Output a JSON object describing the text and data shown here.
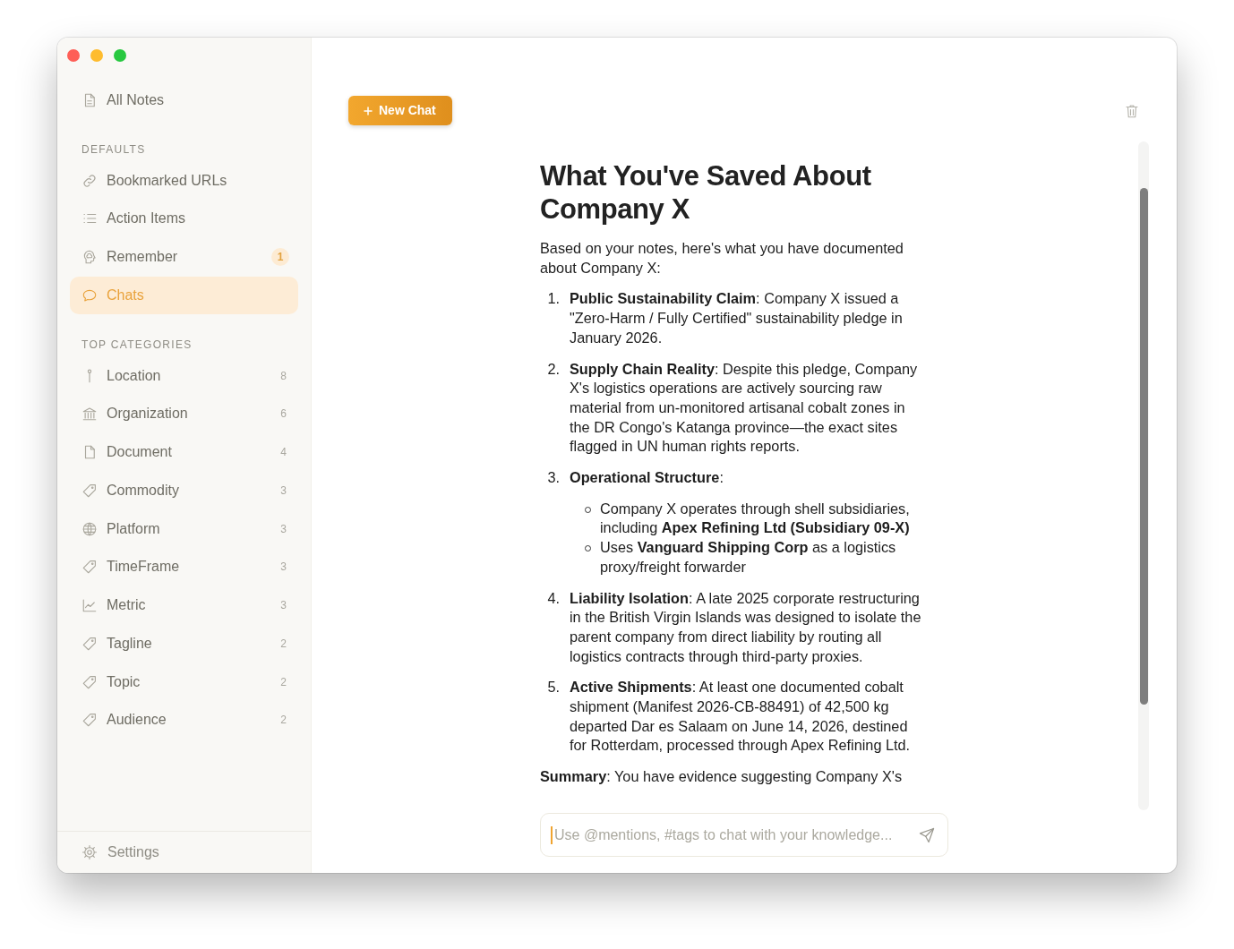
{
  "sidebar": {
    "top_item": {
      "label": "All Notes",
      "kind": "notes",
      "selected": false
    },
    "sections": [
      {
        "heading": "DEFAULTS",
        "items": [
          {
            "label": "Bookmarked URLs",
            "kind": "link",
            "selected": false
          },
          {
            "label": "Action Items",
            "kind": "list",
            "selected": false
          },
          {
            "label": "Remember",
            "kind": "memory",
            "selected": false,
            "badge": "1"
          },
          {
            "label": "Chats",
            "kind": "chat",
            "selected": true
          }
        ]
      },
      {
        "heading": "TOP CATEGORIES",
        "items": [
          {
            "label": "Location",
            "kind": "location",
            "selected": false,
            "count": "8"
          },
          {
            "label": "Organization",
            "kind": "organization",
            "selected": false,
            "count": "6"
          },
          {
            "label": "Document",
            "kind": "document",
            "selected": false,
            "count": "4"
          },
          {
            "label": "Commodity",
            "kind": "tag",
            "selected": false,
            "count": "3"
          },
          {
            "label": "Platform",
            "kind": "platform",
            "selected": false,
            "count": "3"
          },
          {
            "label": "TimeFrame",
            "kind": "tag",
            "selected": false,
            "count": "3"
          },
          {
            "label": "Metric",
            "kind": "metric",
            "selected": false,
            "count": "3"
          },
          {
            "label": "Tagline",
            "kind": "tag",
            "selected": false,
            "count": "2"
          },
          {
            "label": "Topic",
            "kind": "tag",
            "selected": false,
            "count": "2"
          },
          {
            "label": "Audience",
            "kind": "tag",
            "selected": false,
            "count": "2"
          }
        ]
      }
    ],
    "footer": {
      "label": "Settings"
    }
  },
  "main": {
    "new_chat_button": {
      "label": "New Chat"
    },
    "message": {
      "title": "What You've Saved About Company X",
      "intro": "Based on your notes, here's what you have documented about Company X:",
      "points": [
        {
          "number": "1.",
          "text": "**Public Sustainability Claim**: Company X issued a \"Zero-Harm / Fully Certified\" sustainability pledge in January 2026."
        },
        {
          "number": "2.",
          "text": "**Supply Chain Reality**: Despite this pledge, Company X's logistics operations are actively sourcing raw material from un-monitored artisanal cobalt zones in the DR Congo's Katanga province—the exact sites flagged in UN human rights reports."
        },
        {
          "number": "3.",
          "text": "**Operational Structure**:",
          "children": [
            {
              "text": "Company X operates through shell subsidiaries, including **Apex Refining Ltd (Subsidiary 09-X)**"
            },
            {
              "text": "Uses **Vanguard Shipping Corp** as a logistics proxy/freight forwarder"
            }
          ]
        },
        {
          "number": "4.",
          "text": "**Liability Isolation**: A late 2025 corporate restructuring in the British Virgin Islands was designed to isolate the parent company from direct liability by routing all logistics contracts through third-party proxies."
        },
        {
          "number": "5.",
          "text": "**Active Shipments**: At least one documented cobalt shipment (Manifest 2026-CB-88491) of 42,500 kg departed Dar es Salaam on June 14, 2026, destined for Rotterdam, processed through Apex Refining Ltd."
        }
      ],
      "summary": "**Summary**: You have evidence suggesting Company X's"
    },
    "composer": {
      "placeholder": "Use @mentions, #tags to chat with your knowledge...",
      "focused": true
    }
  }
}
